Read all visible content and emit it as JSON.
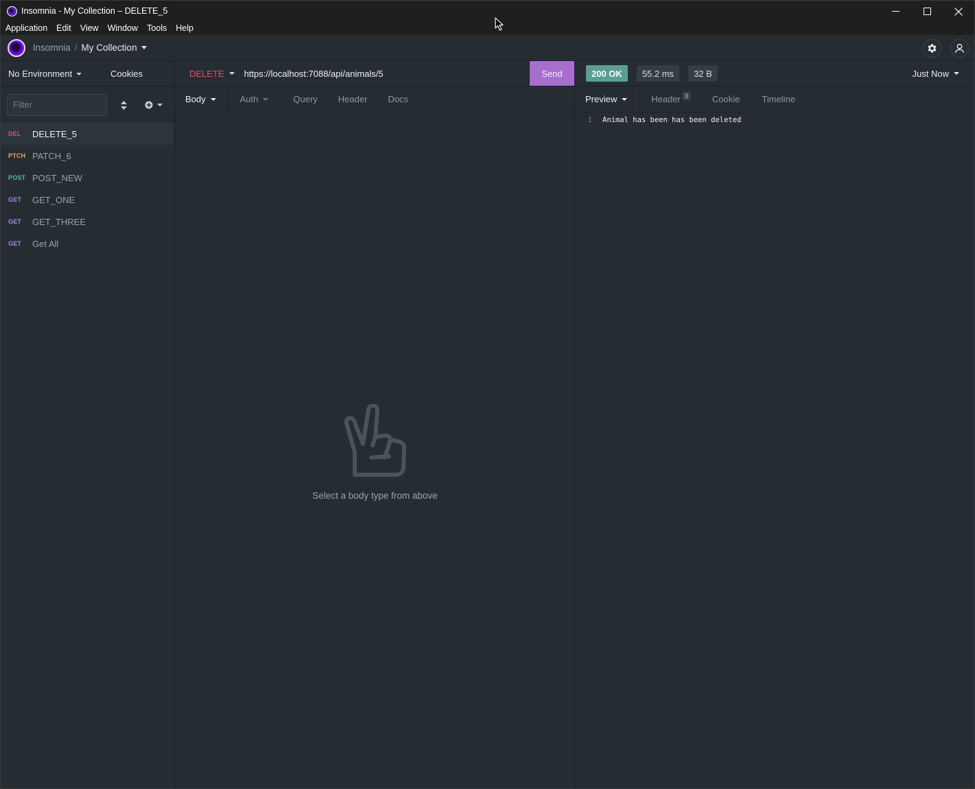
{
  "window": {
    "title": "Insomnia - My Collection – DELETE_5",
    "controls": {
      "minimize": "—",
      "maximize": "□",
      "close": "✕"
    }
  },
  "menu": [
    "Application",
    "Edit",
    "View",
    "Window",
    "Tools",
    "Help"
  ],
  "header": {
    "breadcrumb_root": "Insomnia",
    "breadcrumb_sep": "/",
    "collection": "My Collection",
    "icons": [
      "settings-gear-icon",
      "account-icon"
    ]
  },
  "sidebar": {
    "environment": "No Environment",
    "cookies": "Cookies",
    "filter_placeholder": "Filter",
    "requests": [
      {
        "method": "DEL",
        "name": "DELETE_5",
        "color": "#e25261",
        "active": true
      },
      {
        "method": "PTCH",
        "name": "PATCH_6",
        "color": "#e8a64c",
        "active": false
      },
      {
        "method": "POST",
        "name": "POST_NEW",
        "color": "#5fb5a5",
        "active": false
      },
      {
        "method": "GET",
        "name": "GET_ONE",
        "color": "#a98bd8",
        "active": false
      },
      {
        "method": "GET",
        "name": "GET_THREE",
        "color": "#a98bd8",
        "active": false
      },
      {
        "method": "GET",
        "name": "Get All",
        "color": "#a98bd8",
        "active": false
      }
    ]
  },
  "request": {
    "method": "DELETE",
    "url": "https://localhost:7088/api/animals/5",
    "send_label": "Send",
    "tabs": [
      "Body",
      "Auth",
      "Query",
      "Header",
      "Docs"
    ],
    "empty_message": "Select a body type from above"
  },
  "response": {
    "status": "200 OK",
    "time": "55.2 ms",
    "size": "32 B",
    "history": "Just Now",
    "tabs": [
      "Preview",
      "Header",
      "Cookie",
      "Timeline"
    ],
    "header_count": "3",
    "line_number": "1",
    "body": "Animal has been has been deleted"
  },
  "colors": {
    "accent": "#7400e1",
    "send": "#a76ecf",
    "status_ok": "#5b9e93",
    "delete": "#e25261"
  }
}
